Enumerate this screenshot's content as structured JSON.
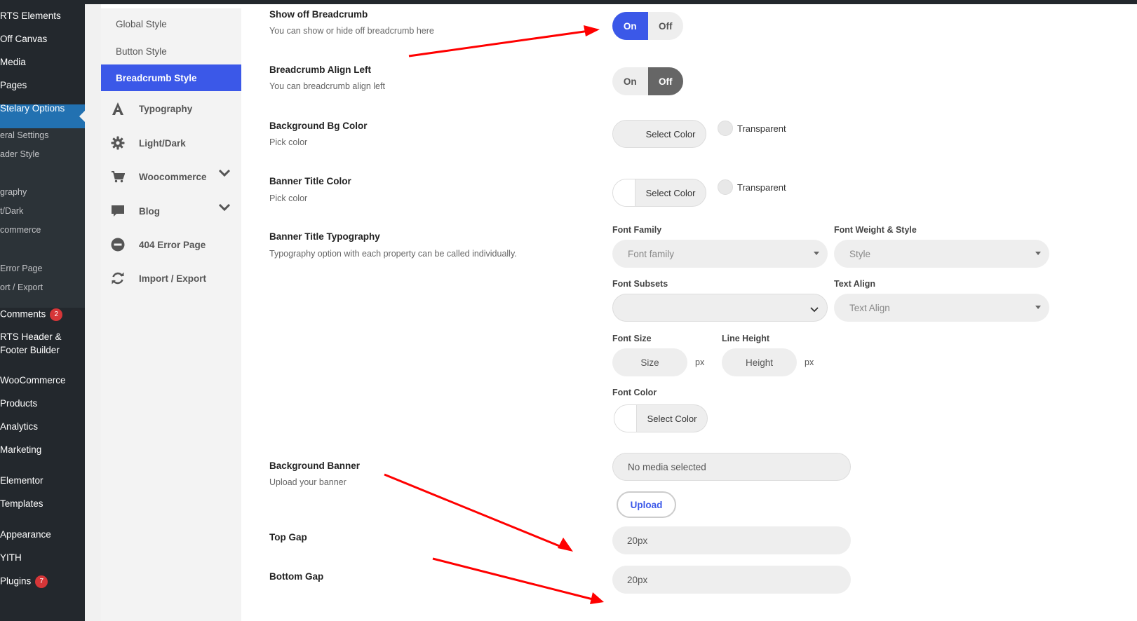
{
  "wp_menu": {
    "items": [
      "RTS Elements",
      "Off Canvas",
      "Media",
      "Pages",
      "Stelary Options"
    ],
    "sub": [
      "eral Settings",
      "ader Style",
      "graphy",
      "t/Dark",
      "commerce",
      "Error Page",
      "ort / Export"
    ],
    "items2": [
      "Comments",
      "RTS Header &",
      "Footer Builder",
      "WooCommerce",
      "Products",
      "Analytics",
      "Marketing",
      "Elementor",
      "Templates",
      "Appearance",
      "YITH",
      "Plugins"
    ],
    "comments_badge": "2",
    "plugins_badge": "7"
  },
  "panel_nav": {
    "global_style": "Global Style",
    "button_style": "Button Style",
    "breadcrumb_style": "Breadcrumb Style",
    "typography": "Typography",
    "light_dark": "Light/Dark",
    "woocommerce": "Woocommerce",
    "blog": "Blog",
    "error_page": "404 Error Page",
    "import_export": "Import / Export"
  },
  "settings": {
    "show_breadcrumb": {
      "label": "Show off Breadcrumb",
      "desc": "You can show or hide off breadcrumb here",
      "on": "On",
      "off": "Off",
      "value": "On"
    },
    "align_left": {
      "label": "Breadcrumb Align Left",
      "desc": "You can breadcrumb align left",
      "on": "On",
      "off": "Off",
      "value": "Off"
    },
    "bg_color": {
      "label": "Background Bg Color",
      "desc": "Pick color",
      "button": "Select Color",
      "transparent": "Transparent"
    },
    "title_color": {
      "label": "Banner Title Color",
      "desc": "Pick color",
      "button": "Select Color",
      "transparent": "Transparent"
    },
    "typography": {
      "label": "Banner Title Typography",
      "desc": "Typography option with each property can be called individually.",
      "font_family_label": "Font Family",
      "font_family_placeholder": "Font family",
      "weight_label": "Font Weight & Style",
      "weight_placeholder": "Style",
      "subsets_label": "Font Subsets",
      "subsets_value": "",
      "align_label": "Text Align",
      "align_placeholder": "Text Align",
      "size_label": "Font Size",
      "size_placeholder": "Size",
      "size_unit": "px",
      "line_height_label": "Line Height",
      "line_height_placeholder": "Height",
      "line_height_unit": "px",
      "color_label": "Font Color",
      "color_button": "Select Color"
    },
    "bg_banner": {
      "label": "Background Banner",
      "desc": "Upload your banner",
      "media": "No media selected",
      "upload": "Upload"
    },
    "top_gap": {
      "label": "Top Gap",
      "value": "20px"
    },
    "bottom_gap": {
      "label": "Bottom Gap",
      "value": "20px"
    }
  },
  "colors": {
    "accent": "#3b58e8",
    "arrow": "#ff0000",
    "wp_dark": "#23282d",
    "wp_active": "#2271b1"
  }
}
